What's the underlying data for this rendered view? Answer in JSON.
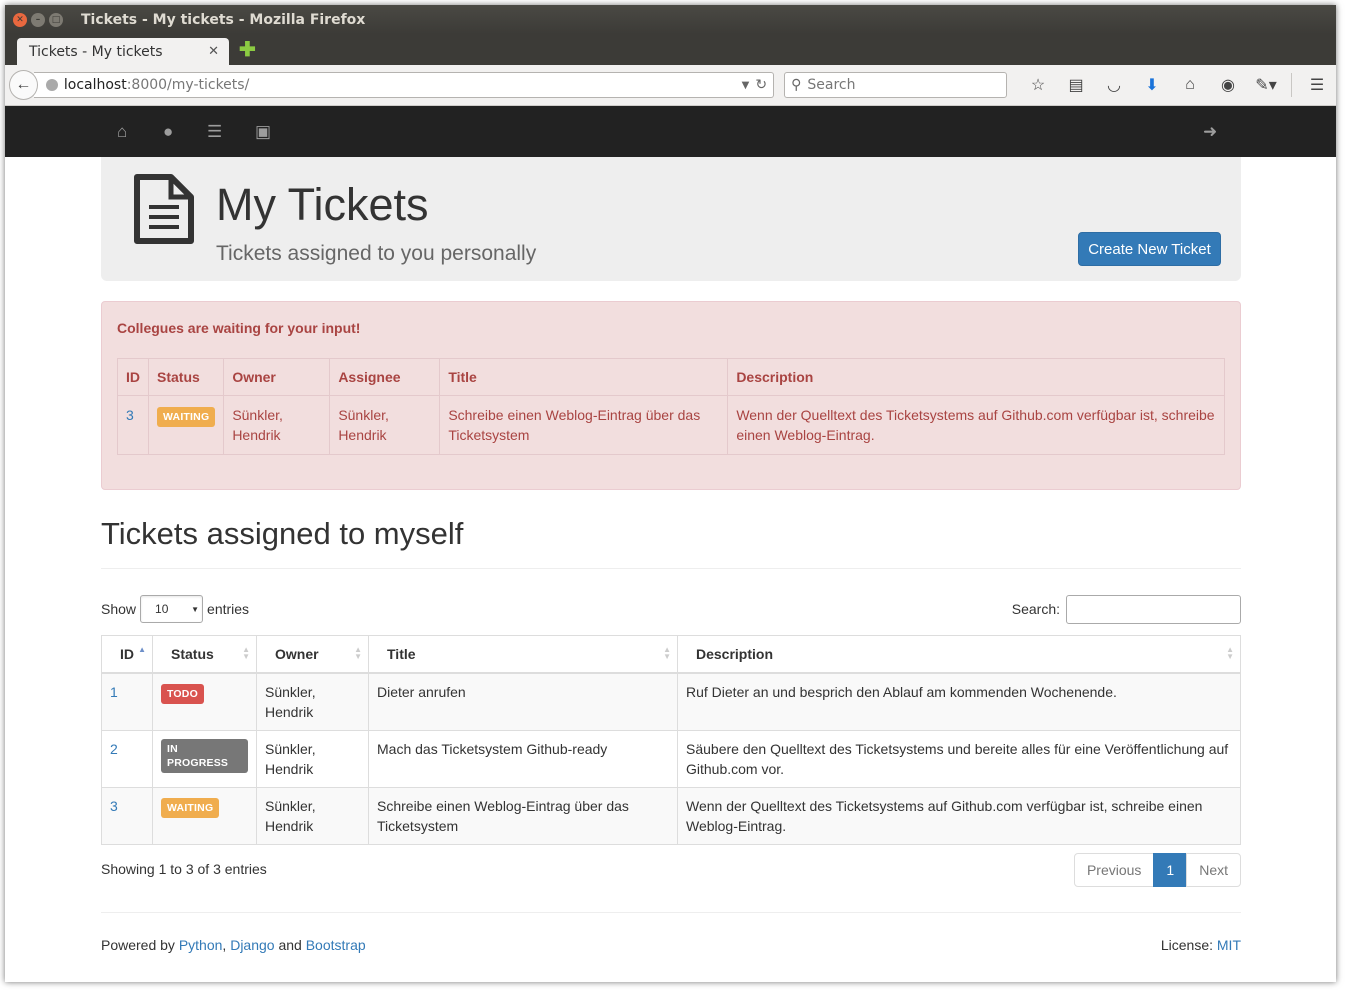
{
  "browser": {
    "window_title": "Tickets - My tickets - Mozilla Firefox",
    "tab_title": "Tickets - My tickets",
    "url_host": "localhost",
    "url_path": ":8000/my-tickets/",
    "search_placeholder": "Search"
  },
  "navbar": {
    "icons": [
      "home-icon",
      "user-icon",
      "list-icon",
      "archive-icon",
      "sign-out-icon"
    ]
  },
  "jumbotron": {
    "title": "My Tickets",
    "subtitle": "Tickets assigned to you personally",
    "create_button": "Create New Ticket"
  },
  "alert": {
    "heading": "Collegues are waiting for your input!",
    "columns": [
      "ID",
      "Status",
      "Owner",
      "Assignee",
      "Title",
      "Description"
    ],
    "rows": [
      {
        "id": "3",
        "status": "WAITING",
        "owner_last": "Sünkler,",
        "owner_first": "Hendrik",
        "assignee_last": "Sünkler,",
        "assignee_first": "Hendrik",
        "title": "Schreibe einen Weblog-Eintrag über das Ticketsystem",
        "description": "Wenn der Quelltext des Ticketsystems auf Github.com verfügbar ist, schreibe einen Weblog-Eintrag."
      }
    ]
  },
  "section": {
    "title": "Tickets assigned to myself",
    "show_label": "Show",
    "entries_label": "entries",
    "length_value": "10",
    "search_label": "Search:",
    "search_value": ""
  },
  "table": {
    "columns": [
      "ID",
      "Status",
      "Owner",
      "Title",
      "Description"
    ],
    "rows": [
      {
        "id": "1",
        "status": "TODO",
        "owner_last": "Sünkler,",
        "owner_first": "Hendrik",
        "title": "Dieter anrufen",
        "description": "Ruf Dieter an und besprich den Ablauf am kommenden Wochenende."
      },
      {
        "id": "2",
        "status": "IN PROGRESS",
        "owner_last": "Sünkler,",
        "owner_first": "Hendrik",
        "title": "Mach das Ticketsystem Github-ready",
        "description": "Säubere den Quelltext des Ticketsystems und bereite alles für eine Veröffentlichung auf Github.com vor."
      },
      {
        "id": "3",
        "status": "WAITING",
        "owner_last": "Sünkler,",
        "owner_first": "Hendrik",
        "title": "Schreibe einen Weblog-Eintrag über das Ticketsystem",
        "description": "Wenn der Quelltext des Ticketsystems auf Github.com verfügbar ist, schreibe einen Weblog-Eintrag."
      }
    ],
    "info": "Showing 1 to 3 of 3 entries",
    "pagination": {
      "previous": "Previous",
      "current": "1",
      "next": "Next"
    }
  },
  "footer": {
    "powered_by": "Powered by",
    "python": "Python",
    "comma": ",",
    "django": "Django",
    "and": "and",
    "bootstrap": "Bootstrap",
    "license_label": "License:",
    "license": "MIT"
  },
  "colors": {
    "primary": "#337ab7",
    "danger": "#d9534f",
    "warning": "#f0ad4e",
    "default": "#777777",
    "alert_bg": "#f2dede",
    "alert_text": "#a94442"
  }
}
